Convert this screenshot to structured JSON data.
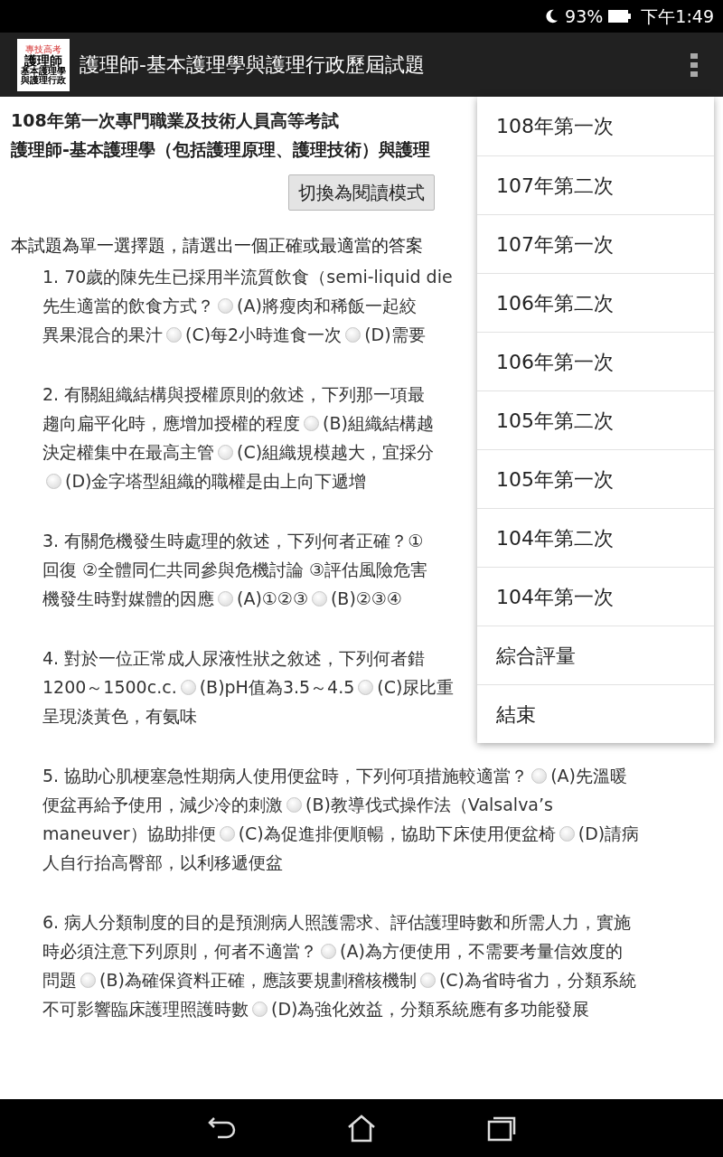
{
  "status_bar": {
    "battery": "93%",
    "time": "下午1:49"
  },
  "app_bar": {
    "logo_lines": [
      "專技高考",
      "護理師",
      "基本護理學",
      "與護理行政"
    ],
    "title": "護理師-基本護理學與護理行政歷屆試題"
  },
  "exam": {
    "heading_lines": [
      "108年第一次專門職業及技術人員高等考試",
      "護理師-基本護理學（包括護理原理、護理技術）與護理"
    ],
    "mode_button": "切換為閱讀模式",
    "instruction": "本試題為單一選擇題，請選出一個正確或最適當的答案",
    "questions": [
      {
        "lines": [
          [
            {
              "kind": "text",
              "text": "1. 70歲的陳先生已採用半流質飲食（semi-liquid die"
            }
          ],
          [
            {
              "kind": "text",
              "text": "先生適當的飲食方式？"
            },
            {
              "kind": "radio",
              "selected": false
            },
            {
              "kind": "text",
              "text": "(A)將瘦肉和稀飯一起絞"
            }
          ],
          [
            {
              "kind": "text",
              "text": "異果混合的果汁"
            },
            {
              "kind": "radio",
              "selected": false
            },
            {
              "kind": "text",
              "text": "(C)每2小時進食一次"
            },
            {
              "kind": "radio",
              "selected": false
            },
            {
              "kind": "text",
              "text": "(D)需要"
            }
          ]
        ]
      },
      {
        "lines": [
          [
            {
              "kind": "text",
              "text": "2. 有關組織結構與授權原則的敘述，下列那一項最"
            }
          ],
          [
            {
              "kind": "text",
              "text": "趨向扁平化時，應增加授權的程度"
            },
            {
              "kind": "radio",
              "selected": false
            },
            {
              "kind": "text",
              "text": "(B)組織結構越"
            }
          ],
          [
            {
              "kind": "text",
              "text": "決定權集中在最高主管"
            },
            {
              "kind": "radio",
              "selected": false
            },
            {
              "kind": "text",
              "text": "(C)組織規模越大，宜採分"
            }
          ],
          [
            {
              "kind": "radio",
              "selected": false
            },
            {
              "kind": "text",
              "text": "(D)金字塔型組織的職權是由上向下遞增"
            }
          ]
        ]
      },
      {
        "lines": [
          [
            {
              "kind": "text",
              "text": "3. 有關危機發生時處理的敘述，下列何者正確？①"
            }
          ],
          [
            {
              "kind": "text",
              "text": "回復 ②全體同仁共同參與危機討論 ③評估風險危害"
            }
          ],
          [
            {
              "kind": "text",
              "text": "機發生時對媒體的因應"
            },
            {
              "kind": "radio",
              "selected": false
            },
            {
              "kind": "text",
              "text": "(A)①②③"
            },
            {
              "kind": "radio",
              "selected": false
            },
            {
              "kind": "text",
              "text": "(B)②③④"
            }
          ]
        ]
      },
      {
        "lines": [
          [
            {
              "kind": "text",
              "text": "4. 對於一位正常成人尿液性狀之敘述，下列何者錯"
            }
          ],
          [
            {
              "kind": "text",
              "text": "1200～1500c.c."
            },
            {
              "kind": "radio",
              "selected": false
            },
            {
              "kind": "text",
              "text": "(B)pH值為3.5～4.5"
            },
            {
              "kind": "radio",
              "selected": false
            },
            {
              "kind": "text",
              "text": "(C)尿比重"
            }
          ],
          [
            {
              "kind": "text",
              "text": "呈現淡黃色，有氨味"
            }
          ]
        ]
      },
      {
        "lines": [
          [
            {
              "kind": "text",
              "text": "5. 協助心肌梗塞急性期病人使用便盆時，下列何項措施較適當？"
            },
            {
              "kind": "radio",
              "selected": false
            },
            {
              "kind": "text",
              "text": "(A)先溫暖"
            }
          ],
          [
            {
              "kind": "text",
              "text": "便盆再給予使用，減少冷的刺激"
            },
            {
              "kind": "radio",
              "selected": false
            },
            {
              "kind": "text",
              "text": "(B)教導伐式操作法（Valsalva’s"
            }
          ],
          [
            {
              "kind": "text",
              "text": "maneuver）協助排便"
            },
            {
              "kind": "radio",
              "selected": false
            },
            {
              "kind": "text",
              "text": "(C)為促進排便順暢，協助下床使用便盆椅"
            },
            {
              "kind": "radio",
              "selected": false
            },
            {
              "kind": "text",
              "text": "(D)請病"
            }
          ],
          [
            {
              "kind": "text",
              "text": "人自行抬高臀部，以利移遞便盆"
            }
          ]
        ]
      },
      {
        "lines": [
          [
            {
              "kind": "text",
              "text": "6. 病人分類制度的目的是預測病人照護需求、評估護理時數和所需人力，實施"
            }
          ],
          [
            {
              "kind": "text",
              "text": "時必須注意下列原則，何者不適當？"
            },
            {
              "kind": "radio",
              "selected": false
            },
            {
              "kind": "text",
              "text": "(A)為方便使用，不需要考量信效度的"
            }
          ],
          [
            {
              "kind": "text",
              "text": "問題"
            },
            {
              "kind": "radio",
              "selected": false
            },
            {
              "kind": "text",
              "text": "(B)為確保資料正確，應該要規劃稽核機制"
            },
            {
              "kind": "radio",
              "selected": false
            },
            {
              "kind": "text",
              "text": "(C)為省時省力，分類系統"
            }
          ],
          [
            {
              "kind": "text",
              "text": "不可影響臨床護理照護時數"
            },
            {
              "kind": "radio",
              "selected": false
            },
            {
              "kind": "text",
              "text": "(D)為強化效益，分類系統應有多功能發展"
            }
          ]
        ]
      }
    ]
  },
  "menu": {
    "items": [
      "108年第一次",
      "107年第二次",
      "107年第一次",
      "106年第二次",
      "106年第一次",
      "105年第二次",
      "105年第一次",
      "104年第二次",
      "104年第一次",
      "綜合評量",
      "結束"
    ]
  }
}
